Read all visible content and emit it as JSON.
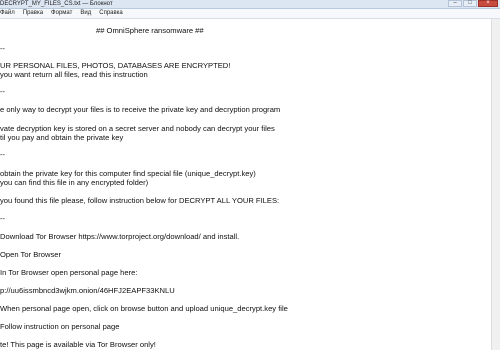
{
  "window": {
    "title": "DECRYPT_MY_FILES_CS.txt — Блокнот"
  },
  "menu": {
    "items": [
      "Файл",
      "Правка",
      "Формат",
      "Вид",
      "Справка"
    ]
  },
  "document": {
    "lines": [
      "## OmniSphere ransomware ##",
      "--",
      "UR PERSONAL FILES, PHOTOS, DATABASES ARE ENCRYPTED!",
      "you want return all files, read this instruction",
      "--",
      "e only way to decrypt your files is to receive the private key and decryption program",
      "vate decryption key is stored on a secret server and nobody can decrypt your files",
      "til you pay and obtain the private key",
      "--",
      "obtain the private key for this computer find special file (unique_decrypt.key)",
      "you can find this file in any encrypted folder)",
      "you found this file please, follow instruction below for DECRYPT ALL YOUR FILES:",
      "--",
      "Download Tor Browser https://www.torproject.org/download/ and install.",
      "Open Tor Browser",
      "In Tor Browser open personal page here:",
      "p://uu6issmbncd3wjkm.onion/46HFJ2EAPF33KNLU",
      "When personal page open, click on browse button and upload unique_decrypt.key file",
      "Follow instruction on personal page",
      "te! This page is available via Tor Browser only!"
    ]
  }
}
